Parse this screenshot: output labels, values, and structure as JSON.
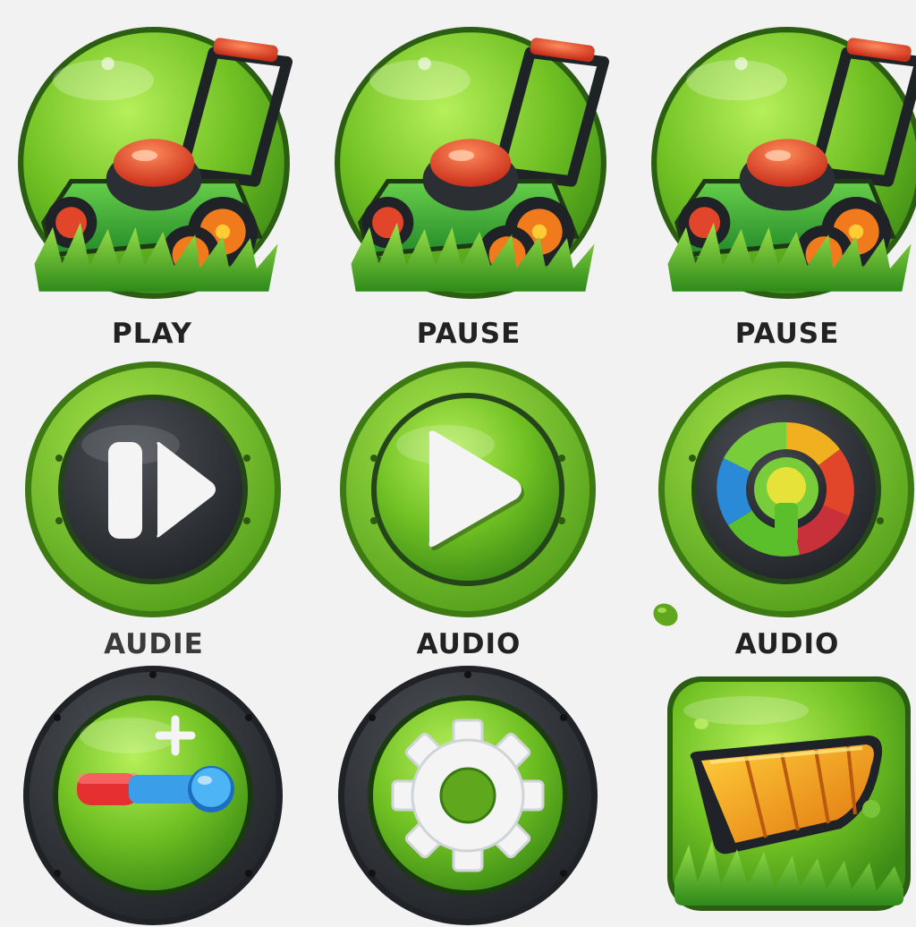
{
  "labels": {
    "row1": [
      "PLAY",
      "PAUSE",
      "PAUSE"
    ],
    "row2": [
      "AUDIE",
      "AUDIO",
      "AUDIO"
    ]
  },
  "colors": {
    "grass_light": "#8fd33a",
    "grass_dark": "#2f8a1c",
    "rim_green": "#5fa81e",
    "rim_dark": "#2b2f33",
    "mower_red": "#e2462a",
    "wheel_orange": "#f07a1c",
    "play_white": "#f4f4f4"
  },
  "icons": [
    "lawn-mower-icon",
    "fast-forward-icon",
    "play-icon",
    "color-wheel-icon",
    "volume-slider-icon",
    "gear-icon",
    "trimmer-blade-icon"
  ]
}
